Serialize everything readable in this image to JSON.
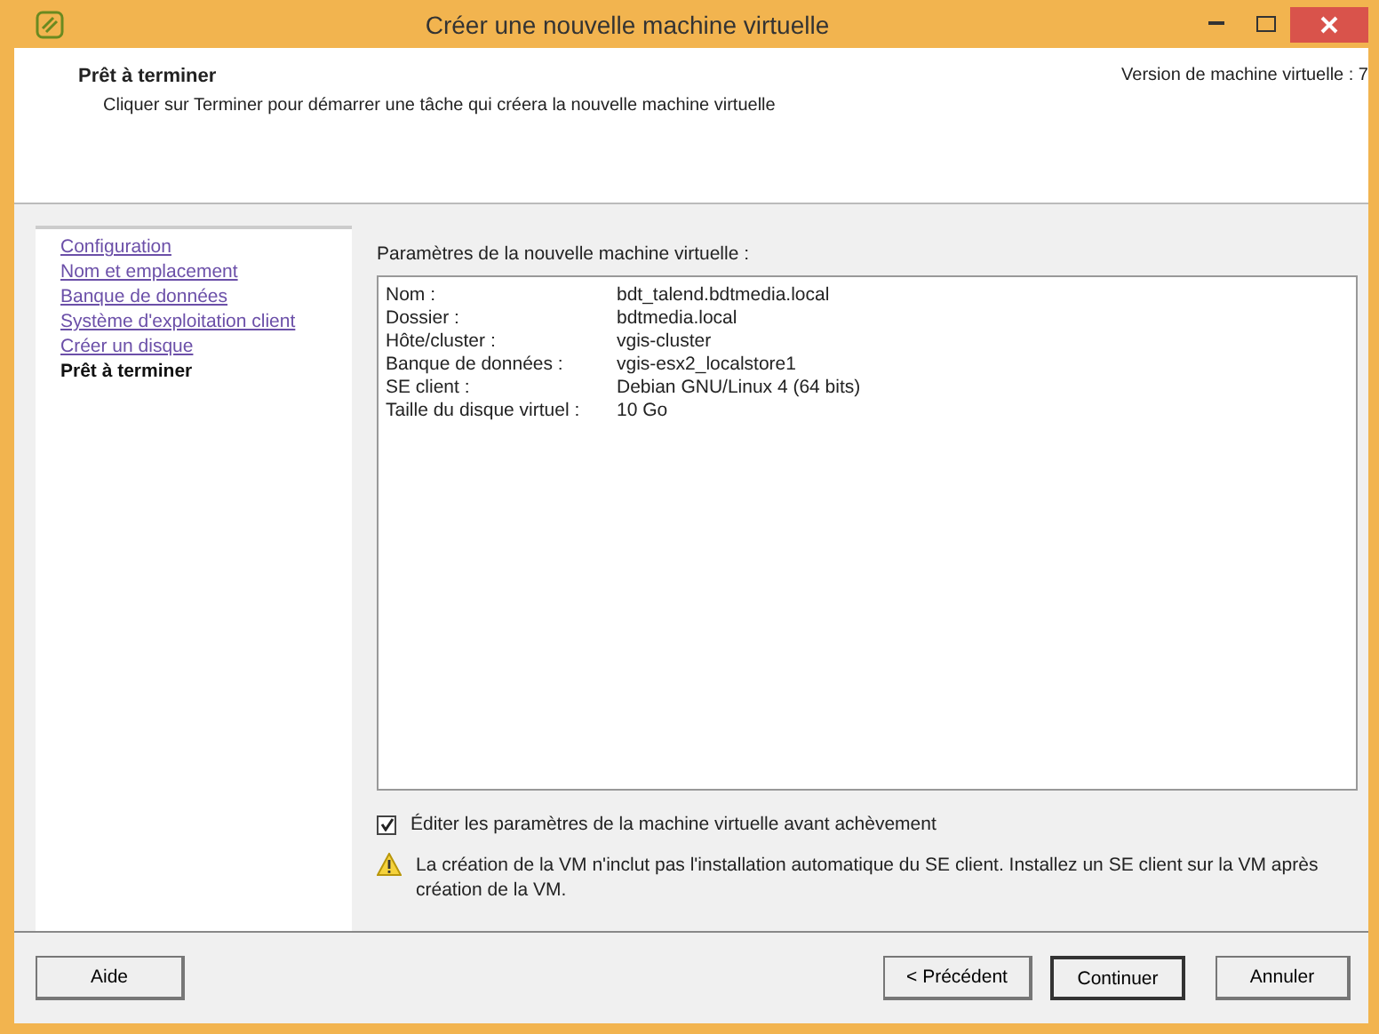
{
  "window": {
    "title": "Créer une nouvelle machine virtuelle"
  },
  "header": {
    "title": "Prêt à terminer",
    "subtitle": "Cliquer sur Terminer pour démarrer une tâche qui créera la nouvelle machine virtuelle",
    "version": "Version de machine virtuelle : 7"
  },
  "steps": [
    {
      "label": "Configuration",
      "selected": false
    },
    {
      "label": "Nom et emplacement",
      "selected": false
    },
    {
      "label": "Banque de données",
      "selected": false
    },
    {
      "label": "Système d'exploitation client",
      "selected": false
    },
    {
      "label": "Créer un disque",
      "selected": false
    },
    {
      "label": "Prêt à terminer",
      "selected": true
    }
  ],
  "summary": {
    "title": "Paramètres de la nouvelle machine virtuelle :",
    "rows": [
      {
        "label": "Nom :",
        "value": "bdt_talend.bdtmedia.local"
      },
      {
        "label": "Dossier :",
        "value": "bdtmedia.local"
      },
      {
        "label": "Hôte/cluster :",
        "value": "vgis-cluster"
      },
      {
        "label": "Banque de données :",
        "value": "vgis-esx2_localstore1"
      },
      {
        "label": "SE client :",
        "value": "Debian GNU/Linux 4 (64 bits)"
      },
      {
        "label": "Taille du disque virtuel :",
        "value": "10 Go"
      }
    ]
  },
  "edit_option": {
    "label": "Éditer les paramètres de la machine virtuelle avant achèvement",
    "checked": true
  },
  "warning": "La création de la VM n'inclut pas l'installation automatique du SE client. Installez un SE client sur la VM après création de la VM.",
  "buttons": {
    "help": "Aide",
    "back": "< Précédent",
    "next": "Continuer",
    "cancel": "Annuler"
  }
}
